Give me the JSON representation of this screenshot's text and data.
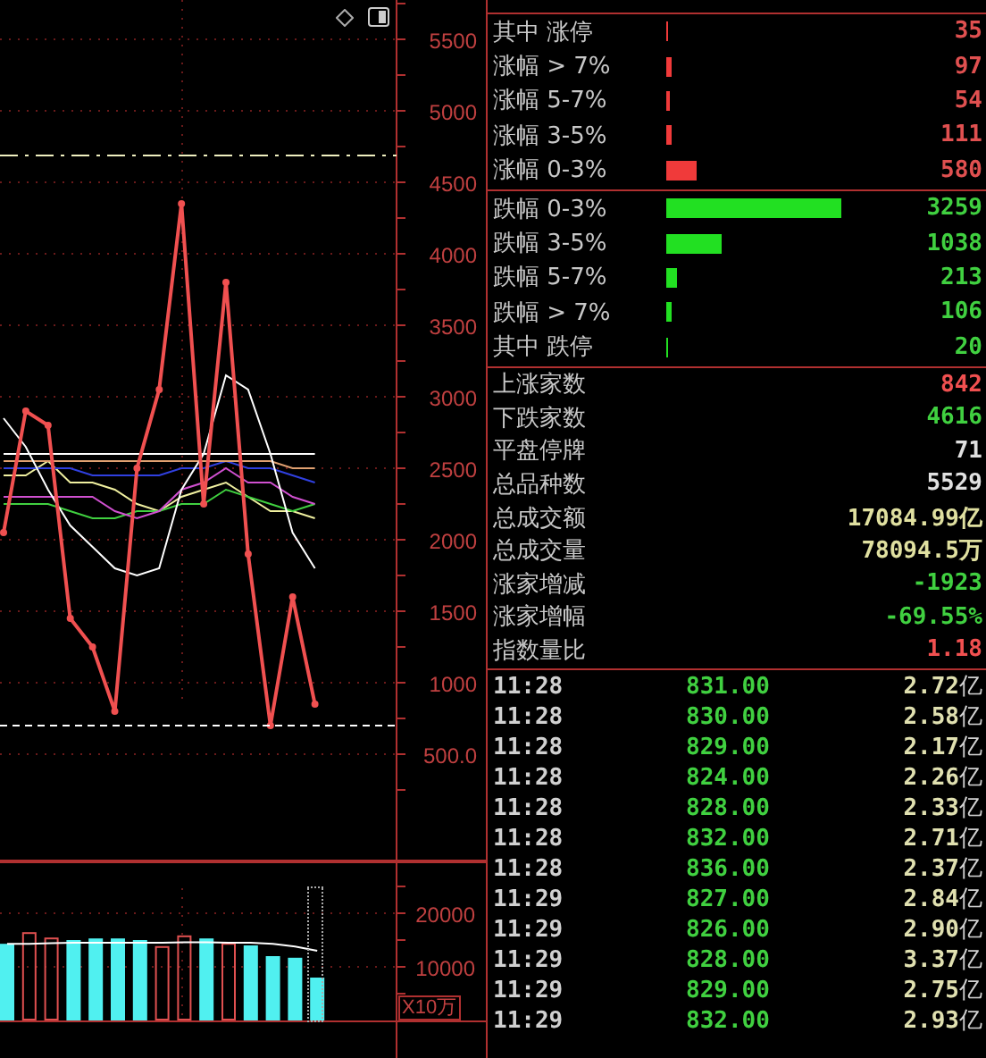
{
  "main_chart": {
    "chart_data": {
      "type": "line",
      "grid": true,
      "ylim": [
        -250,
        5775
      ],
      "yticks": [
        {
          "value": 500,
          "label": "500.0"
        },
        1000,
        1500,
        2000,
        2500,
        3000,
        3500,
        4000,
        4500,
        5000,
        5500
      ],
      "series": [
        {
          "color": "#f05050",
          "marker": "o",
          "values": [
            2050,
            2900,
            2800,
            1450,
            1250,
            800,
            2500,
            3050,
            4350,
            2250,
            3800,
            1900,
            700,
            1600,
            850
          ]
        },
        {
          "color": "#ffffff",
          "values": [
            2850,
            2650,
            2350,
            2100,
            1950,
            1800,
            1750,
            1800,
            2350,
            2600,
            3150,
            3050,
            2600,
            2050,
            1800
          ]
        },
        {
          "color": "#ffffff",
          "values": [
            2600,
            2600,
            2600,
            2600,
            2600,
            2600,
            2600,
            2600,
            2600,
            2600,
            2600,
            2600,
            2600,
            2600,
            2600
          ]
        },
        {
          "color": "#e0a070",
          "values": [
            2550,
            2550,
            2550,
            2550,
            2550,
            2550,
            2550,
            2550,
            2550,
            2550,
            2550,
            2550,
            2550,
            2500,
            2500
          ]
        },
        {
          "color": "#3040e0",
          "values": [
            2500,
            2500,
            2500,
            2500,
            2450,
            2450,
            2450,
            2450,
            2500,
            2500,
            2550,
            2500,
            2500,
            2450,
            2400
          ]
        },
        {
          "color": "#d050d0",
          "values": [
            2300,
            2300,
            2300,
            2300,
            2300,
            2200,
            2150,
            2200,
            2350,
            2400,
            2500,
            2400,
            2400,
            2300,
            2250
          ]
        },
        {
          "color": "#40d040",
          "values": [
            2250,
            2250,
            2250,
            2200,
            2150,
            2150,
            2200,
            2200,
            2250,
            2250,
            2350,
            2300,
            2250,
            2200,
            2250
          ]
        },
        {
          "color": "#f0f0a0",
          "values": [
            2450,
            2450,
            2550,
            2400,
            2400,
            2350,
            2250,
            2200,
            2300,
            2350,
            2400,
            2300,
            2200,
            2200,
            2150
          ]
        }
      ]
    }
  },
  "volume_chart": {
    "unit": "X10万",
    "chart_data": {
      "type": "bar",
      "grid": true,
      "ylim": [
        0,
        29667
      ],
      "yticks": [
        10000,
        20000
      ],
      "series": [
        {
          "color": "#50f0f0",
          "values": [
            14300,
            null,
            null,
            15000,
            15300,
            15300,
            15000,
            null,
            null,
            15300,
            null,
            14000,
            12000,
            11700,
            8000
          ]
        },
        {
          "color": "#e05050",
          "values": [
            null,
            16300,
            15300,
            null,
            null,
            null,
            null,
            13700,
            15700,
            null,
            14300,
            null,
            null,
            null,
            null
          ]
        },
        {
          "color": "#ffffff",
          "type": "line",
          "values": [
            14300,
            14300,
            14400,
            14500,
            14500,
            14500,
            14500,
            14500,
            14600,
            14600,
            14500,
            14500,
            14300,
            13800,
            13000
          ]
        }
      ]
    }
  },
  "advances": [
    {
      "label": "其中 涨停",
      "value": "35"
    },
    {
      "label": "涨幅 > 7%",
      "value": "97"
    },
    {
      "label": "涨幅 5-7%",
      "value": "54"
    },
    {
      "label": "涨幅 3-5%",
      "value": "111"
    },
    {
      "label": "涨幅 0-3%",
      "value": "580"
    }
  ],
  "declines": [
    {
      "label": "跌幅 0-3%",
      "value": "3259"
    },
    {
      "label": "跌幅 3-5%",
      "value": "1038"
    },
    {
      "label": "跌幅 5-7%",
      "value": "213"
    },
    {
      "label": "跌幅 > 7%",
      "value": "106"
    },
    {
      "label": "其中 跌停",
      "value": "20"
    }
  ],
  "stats": [
    {
      "label": "上涨家数",
      "value": "842",
      "color": "#f05050"
    },
    {
      "label": "下跌家数",
      "value": "4616",
      "color": "#40d040"
    },
    {
      "label": "平盘停牌",
      "value": "71",
      "color": "#e0e0e0"
    },
    {
      "label": "总品种数",
      "value": "5529",
      "color": "#e0e0e0"
    },
    {
      "label": "总成交额",
      "value": "17084.99亿",
      "color": "#e0e0a0"
    },
    {
      "label": "总成交量",
      "value": "78094.5万",
      "color": "#e0e0a0"
    },
    {
      "label": "涨家增减",
      "value": "-1923",
      "color": "#40d040"
    },
    {
      "label": "涨家增幅",
      "value": "-69.55%",
      "color": "#40d040"
    },
    {
      "label": "指数量比",
      "value": "1.18",
      "color": "#f05050"
    }
  ],
  "ticks": [
    {
      "time": "11:28",
      "price": "831.00",
      "amount": "2.72",
      "unit": "亿"
    },
    {
      "time": "11:28",
      "price": "830.00",
      "amount": "2.58",
      "unit": "亿"
    },
    {
      "time": "11:28",
      "price": "829.00",
      "amount": "2.17",
      "unit": "亿"
    },
    {
      "time": "11:28",
      "price": "824.00",
      "amount": "2.26",
      "unit": "亿"
    },
    {
      "time": "11:28",
      "price": "828.00",
      "amount": "2.33",
      "unit": "亿"
    },
    {
      "time": "11:28",
      "price": "832.00",
      "amount": "2.71",
      "unit": "亿"
    },
    {
      "time": "11:28",
      "price": "836.00",
      "amount": "2.37",
      "unit": "亿"
    },
    {
      "time": "11:29",
      "price": "827.00",
      "amount": "2.84",
      "unit": "亿"
    },
    {
      "time": "11:29",
      "price": "826.00",
      "amount": "2.90",
      "unit": "亿"
    },
    {
      "time": "11:29",
      "price": "828.00",
      "amount": "3.37",
      "unit": "亿"
    },
    {
      "time": "11:29",
      "price": "829.00",
      "amount": "2.75",
      "unit": "亿"
    },
    {
      "time": "11:29",
      "price": "832.00",
      "amount": "2.93",
      "unit": "亿"
    }
  ]
}
